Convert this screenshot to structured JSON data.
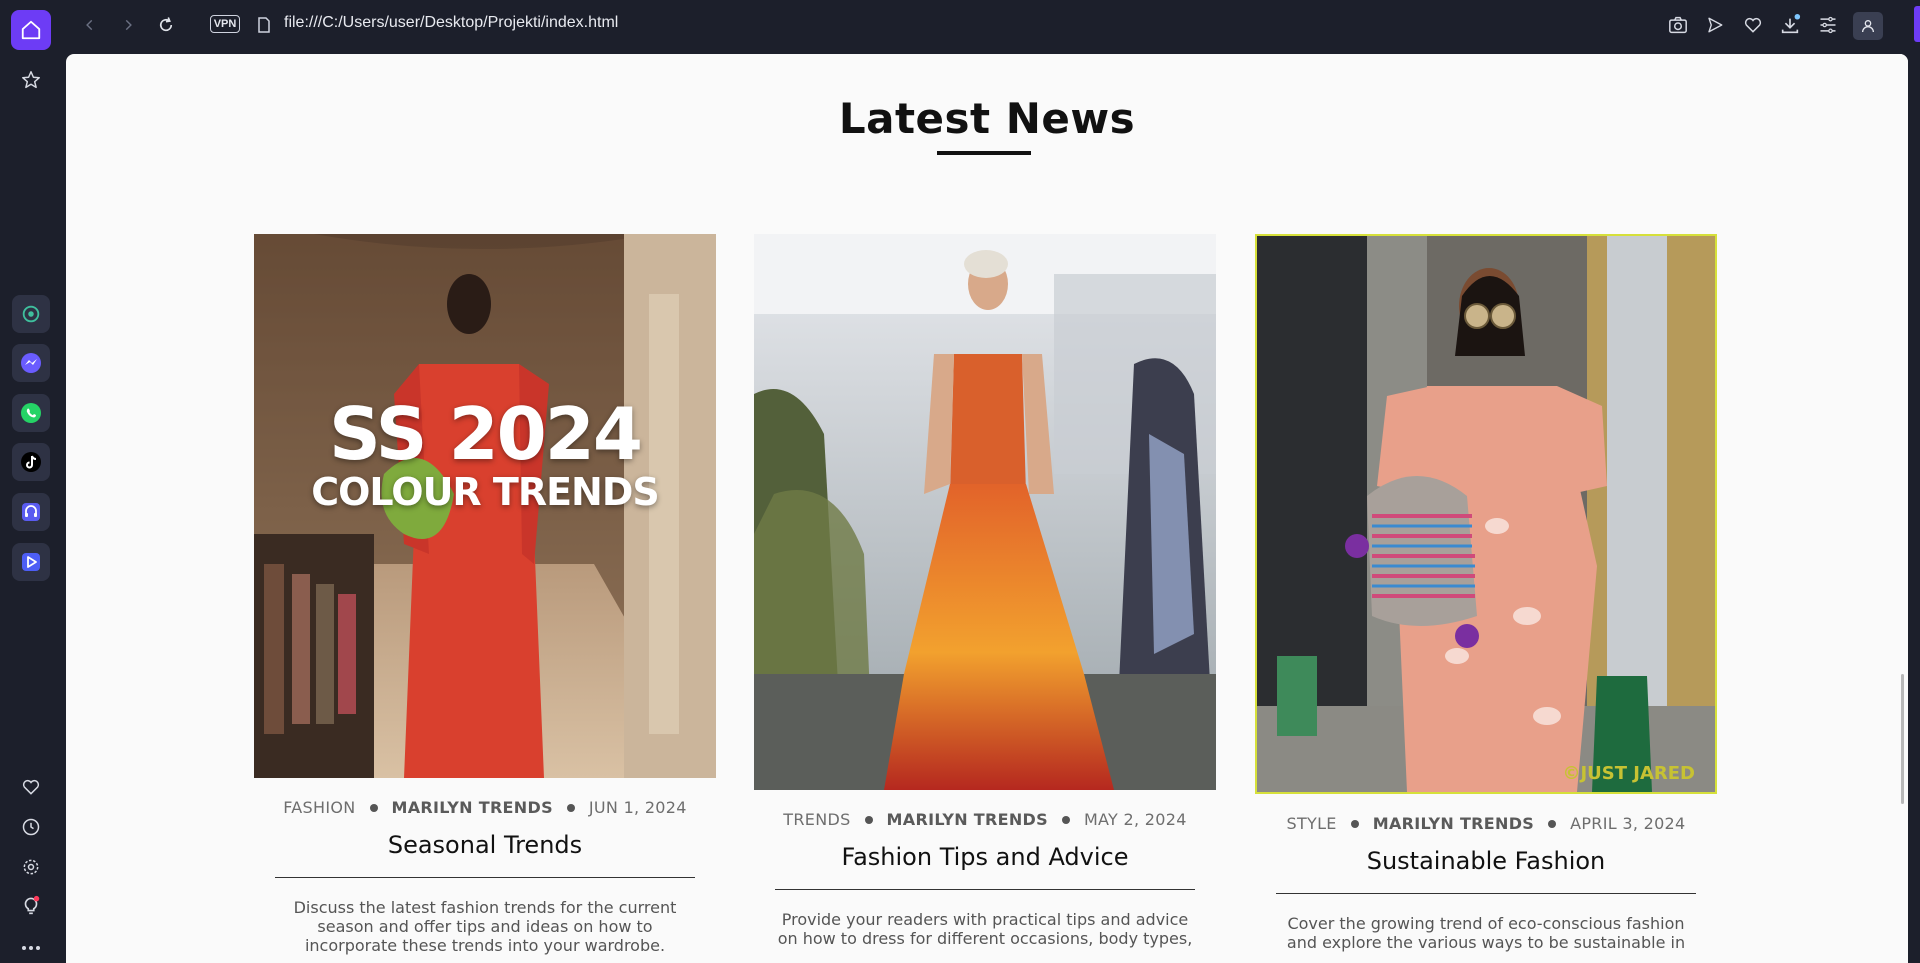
{
  "browser": {
    "url": "file:///C:/Users/user/Desktop/Projekti/index.html",
    "vpn_label": "VPN",
    "colors": {
      "accent": "#6d3cf5",
      "chrome": "#1c1f2b"
    }
  },
  "sidebar": {
    "apps": [
      "chatgpt-icon",
      "messenger-icon",
      "whatsapp-icon",
      "tiktok-icon",
      "music-icon",
      "player-icon"
    ]
  },
  "page": {
    "section_title": "Latest News",
    "cards": [
      {
        "category": "FASHION",
        "author": "MARILYN TRENDS",
        "date": "JUN 1, 2024",
        "title": "Seasonal Trends",
        "description": "Discuss the latest fashion trends for the current season and offer tips and ideas on how to incorporate these trends into your wardrobe.",
        "overlay_big": "SS 2024",
        "overlay_small": "COLOUR TRENDS"
      },
      {
        "category": "TRENDS",
        "author": "MARILYN TRENDS",
        "date": "MAY 2, 2024",
        "title": "Fashion Tips and Advice",
        "description": "Provide your readers with practical tips and advice on how to dress for different occasions, body types,"
      },
      {
        "category": "STYLE",
        "author": "MARILYN TRENDS",
        "date": "APRIL 3, 2024",
        "title": "Sustainable Fashion",
        "description": "Cover the growing trend of eco-conscious fashion and explore the various ways to be sustainable in",
        "watermark": "©JUST JARED"
      }
    ]
  }
}
